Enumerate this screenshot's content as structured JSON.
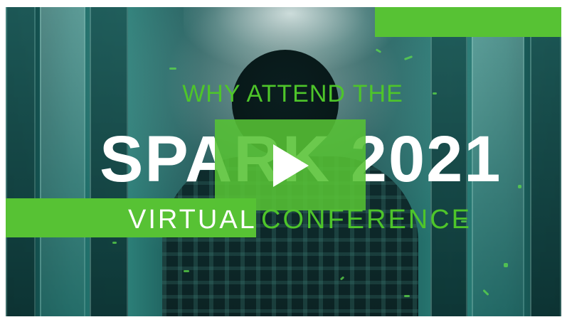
{
  "video": {
    "headline_small": "WHY ATTEND THE",
    "headline_big": "SPARK 2021",
    "sub_white": "VIRTUAL",
    "sub_green": "CONFERENCE"
  },
  "colors": {
    "accent_green": "#57c234",
    "text_green": "#4ec52a",
    "text_white": "#ffffff"
  },
  "icons": {
    "play": "play-icon"
  }
}
